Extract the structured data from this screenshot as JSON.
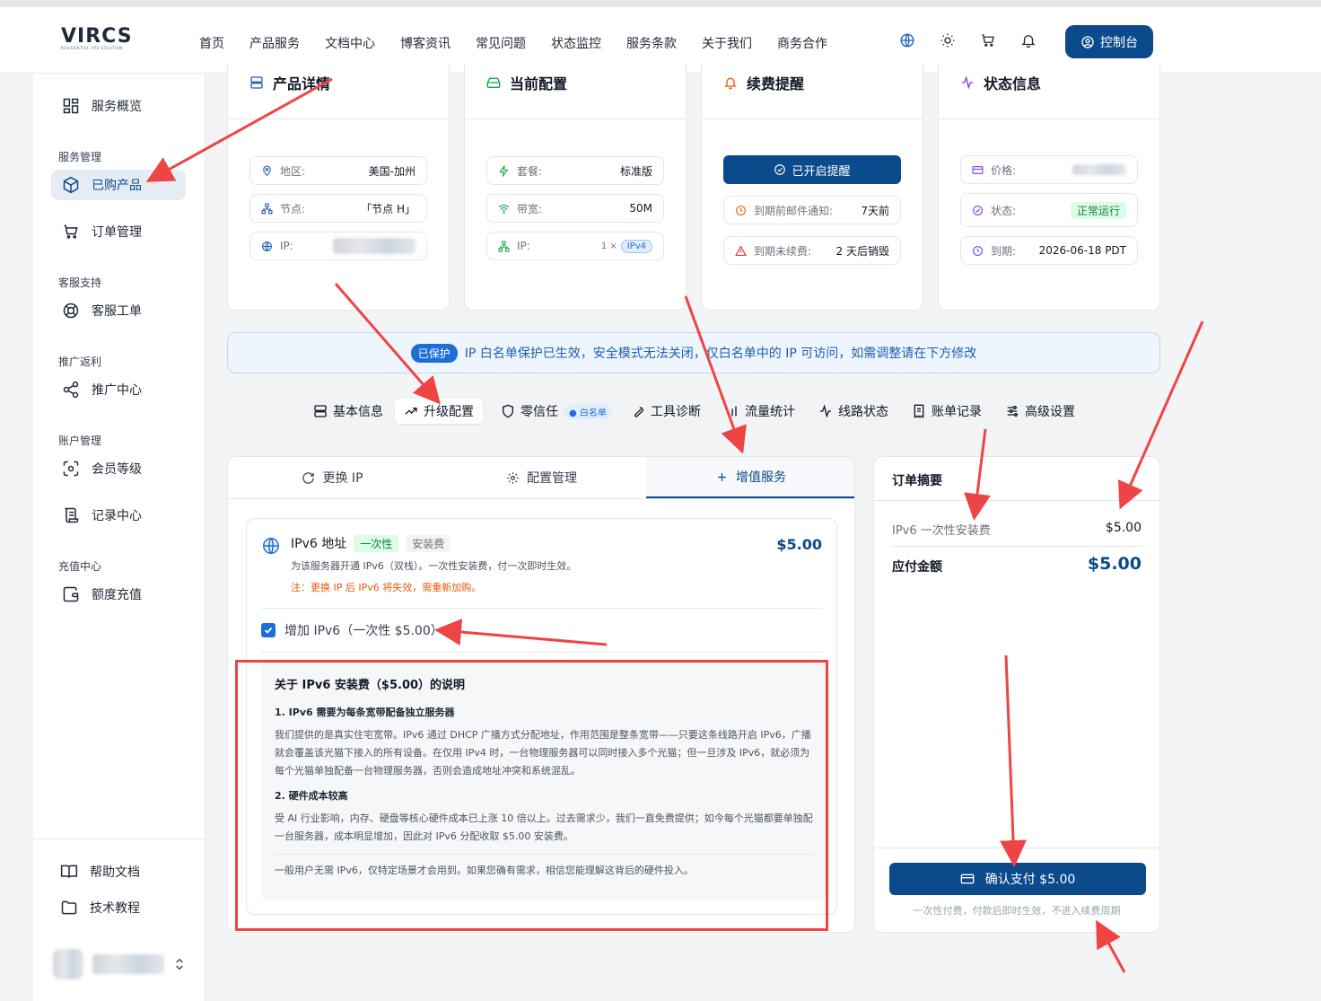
{
  "header": {
    "logo_text": "VIRCS",
    "logo_sub": "RESIDENTIAL VPS SOLUTION",
    "nav": [
      "首页",
      "产品服务",
      "文档中心",
      "博客资讯",
      "常见问题",
      "状态监控",
      "服务条款",
      "关于我们",
      "商务合作"
    ],
    "console_label": "控制台"
  },
  "sidebar": {
    "overview": "服务概览",
    "group_service": "服务管理",
    "purchased": "已购产品",
    "orders": "订单管理",
    "group_support": "客服支持",
    "tickets": "客服工单",
    "group_promo": "推广返利",
    "promo_center": "推广中心",
    "group_account": "账户管理",
    "member_level": "会员等级",
    "records": "记录中心",
    "group_recharge": "充值中心",
    "quota_recharge": "额度充值",
    "help_docs": "帮助文档",
    "tutorials": "技术教程"
  },
  "cards": {
    "product": {
      "title": "产品详情",
      "region_label": "地区:",
      "region_value": "美国-加州",
      "node_label": "节点:",
      "node_value": "「节点 H」",
      "ip_label": "IP:"
    },
    "config": {
      "title": "当前配置",
      "plan_label": "套餐:",
      "plan_value": "标准版",
      "bw_label": "带宽:",
      "bw_value": "50M",
      "ip_label": "IP:",
      "ip_count": "1 ×",
      "ip_type": "IPv4"
    },
    "renew": {
      "title": "续费提醒",
      "enabled_button": "已开启提醒",
      "email_label": "到期前邮件通知:",
      "email_value": "7天前",
      "unrenewed_label": "到期未续费:",
      "unrenewed_value": "2 天后销毁"
    },
    "status": {
      "title": "状态信息",
      "price_label": "价格:",
      "state_label": "状态:",
      "state_value": "正常运行",
      "expire_label": "到期:",
      "expire_value": "2026-06-18 PDT"
    }
  },
  "banner": {
    "badge": "已保护",
    "text": "IP 白名单保护已生效，安全模式无法关闭，仅白名单中的 IP 可访问，如需调整请在下方修改"
  },
  "tabs": {
    "basic": "基本信息",
    "upgrade": "升级配置",
    "zerotrust": "零信任",
    "zerotrust_tag": "白名单",
    "tools": "工具诊断",
    "traffic": "流量统计",
    "route": "线路状态",
    "billing": "账单记录",
    "advanced": "高级设置"
  },
  "panel": {
    "tab_change_ip": "更换 IP",
    "tab_config": "配置管理",
    "tab_addon": "增值服务",
    "ipv6_title": "IPv6 地址",
    "ipv6_tag_once": "一次性",
    "ipv6_tag_fee": "安装费",
    "ipv6_price": "$5.00",
    "ipv6_desc": "为该服务器开通 IPv6（双栈）。一次性安装费，付一次即时生效。",
    "ipv6_warn": "注：更换 IP 后 IPv6 将失效，需重新加购。",
    "checkbox_label": "增加 IPv6（一次性 $5.00）",
    "note_title": "关于 IPv6 安装费（$5.00）的说明",
    "note_h1": "1. IPv6 需要为每条宽带配备独立服务器",
    "note_p1": "我们提供的是真实住宅宽带。IPv6 通过 DHCP 广播方式分配地址，作用范围是整条宽带——只要这条线路开启 IPv6，广播就会覆盖该光猫下接入的所有设备。在仅用 IPv4 时，一台物理服务器可以同时接入多个光猫；但一旦涉及 IPv6，就必须为每个光猫单独配备一台物理服务器，否则会造成地址冲突和系统混乱。",
    "note_h2": "2. 硬件成本较高",
    "note_p2": "受 AI 行业影响，内存、硬盘等核心硬件成本已上涨 10 倍以上。过去需求少，我们一直免费提供；如今每个光猫都要单独配一台服务器，成本明显增加，因此对 IPv6 分配收取 $5.00 安装费。",
    "note_footer": "一般用户无需 IPv6，仅特定场景才会用到。如果您确有需求，相信您能理解这背后的硬件投入。"
  },
  "summary": {
    "title": "订单摘要",
    "item_label": "IPv6 一次性安装费",
    "item_value": "$5.00",
    "total_label": "应付金额",
    "total_value": "$5.00",
    "pay_button": "确认支付 $5.00",
    "pay_note": "一次性付费，付款后即时生效，不进入续费周期"
  },
  "colors": {
    "primary": "#0b4a8b",
    "annotation_red": "#ef4444",
    "success_green": "#15803d",
    "warning_orange": "#ea580c"
  }
}
